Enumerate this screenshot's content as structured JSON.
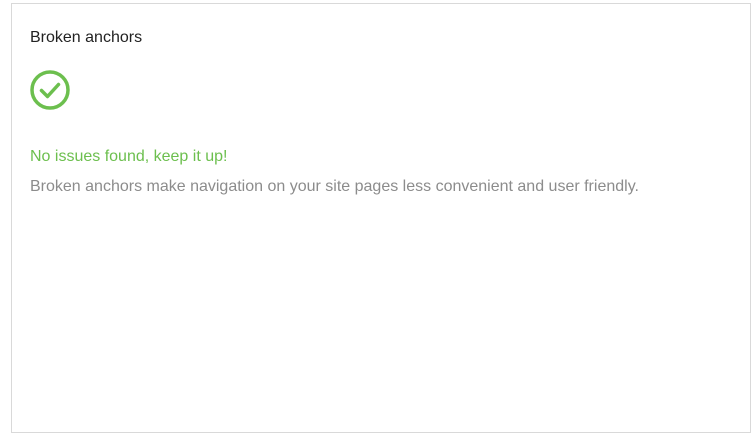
{
  "card": {
    "title": "Broken anchors",
    "status": {
      "icon": "check-circle-icon",
      "title": "No issues found, keep it up!",
      "description": "Broken anchors make navigation on your site pages less convenient and user friendly."
    }
  },
  "colors": {
    "success": "#6cbf4e",
    "title_text": "#222222",
    "description_text": "#8c8c8c",
    "border": "#d9d9d9"
  }
}
